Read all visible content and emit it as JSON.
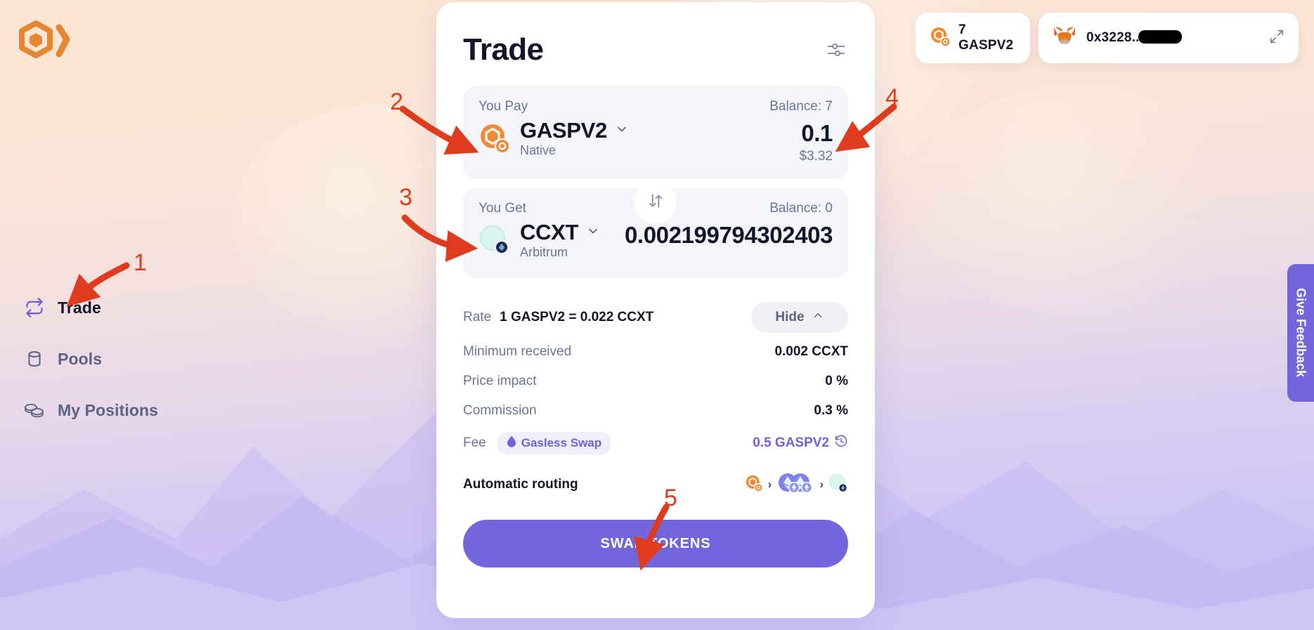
{
  "brand": {
    "logo_icon": "hexagon-chevron-logo",
    "accent": "#e5872f",
    "primary": "#7366dd"
  },
  "sidebar": {
    "items": [
      {
        "label": "Trade",
        "icon": "swap-arrows-icon",
        "active": true
      },
      {
        "label": "Pools",
        "icon": "database-icon",
        "active": false
      },
      {
        "label": "My Positions",
        "icon": "coins-stack-icon",
        "active": false
      }
    ]
  },
  "topbar": {
    "balance_chip": {
      "icon": "gaspv2-token-icon",
      "text": "7 GASPV2"
    },
    "wallet_chip": {
      "icon": "metamask-fox-icon",
      "address": "0x3228..",
      "redacted": true,
      "expand_icon": "expand-arrows-icon"
    }
  },
  "card": {
    "title": "Trade",
    "settings_icon": "sliders-icon",
    "pay": {
      "label": "You Pay",
      "balance": "Balance: 7",
      "token_symbol": "GASPV2",
      "token_chain": "Native",
      "token_icon": "gaspv2-token-icon",
      "chevron_icon": "chevron-down-icon",
      "amount": "0.1",
      "amount_usd": "$3.32"
    },
    "switch_icon": "arrows-up-down-icon",
    "get": {
      "label": "You Get",
      "balance": "Balance: 0",
      "token_symbol": "CCXT",
      "token_chain": "Arbitrum",
      "token_icon": "ccxt-token-icon",
      "chevron_icon": "chevron-down-icon",
      "amount": "0.002199794302403"
    },
    "details": {
      "rate_label": "Rate",
      "rate_value": "1 GASPV2 = 0.022 CCXT",
      "hide_label": "Hide",
      "hide_chevron_icon": "chevron-up-icon",
      "rows": [
        {
          "label": "Minimum received",
          "value": "0.002 CCXT"
        },
        {
          "label": "Price impact",
          "value": "0 %"
        },
        {
          "label": "Commission",
          "value": "0.3 %"
        }
      ],
      "fee_label": "Fee",
      "fee_badge": "Gasless Swap",
      "fee_badge_icon": "droplet-icon",
      "fee_value": "0.5 GASPV2",
      "fee_history_icon": "clock-rewind-icon",
      "routing_label": "Automatic routing",
      "routing_icons": [
        "gaspv2-token-icon",
        "eth-pair-icon",
        "ccxt-token-icon"
      ],
      "routing_separator": "›"
    },
    "cta_label": "SWAP TOKENS"
  },
  "feedback_tab": {
    "label": "Give Feedback"
  },
  "annotations": [
    {
      "number": "1",
      "target": "sidebar-item-trade"
    },
    {
      "number": "2",
      "target": "pay-token-selector"
    },
    {
      "number": "3",
      "target": "get-token-selector"
    },
    {
      "number": "4",
      "target": "pay-amount"
    },
    {
      "number": "5",
      "target": "swap-tokens-button"
    }
  ]
}
